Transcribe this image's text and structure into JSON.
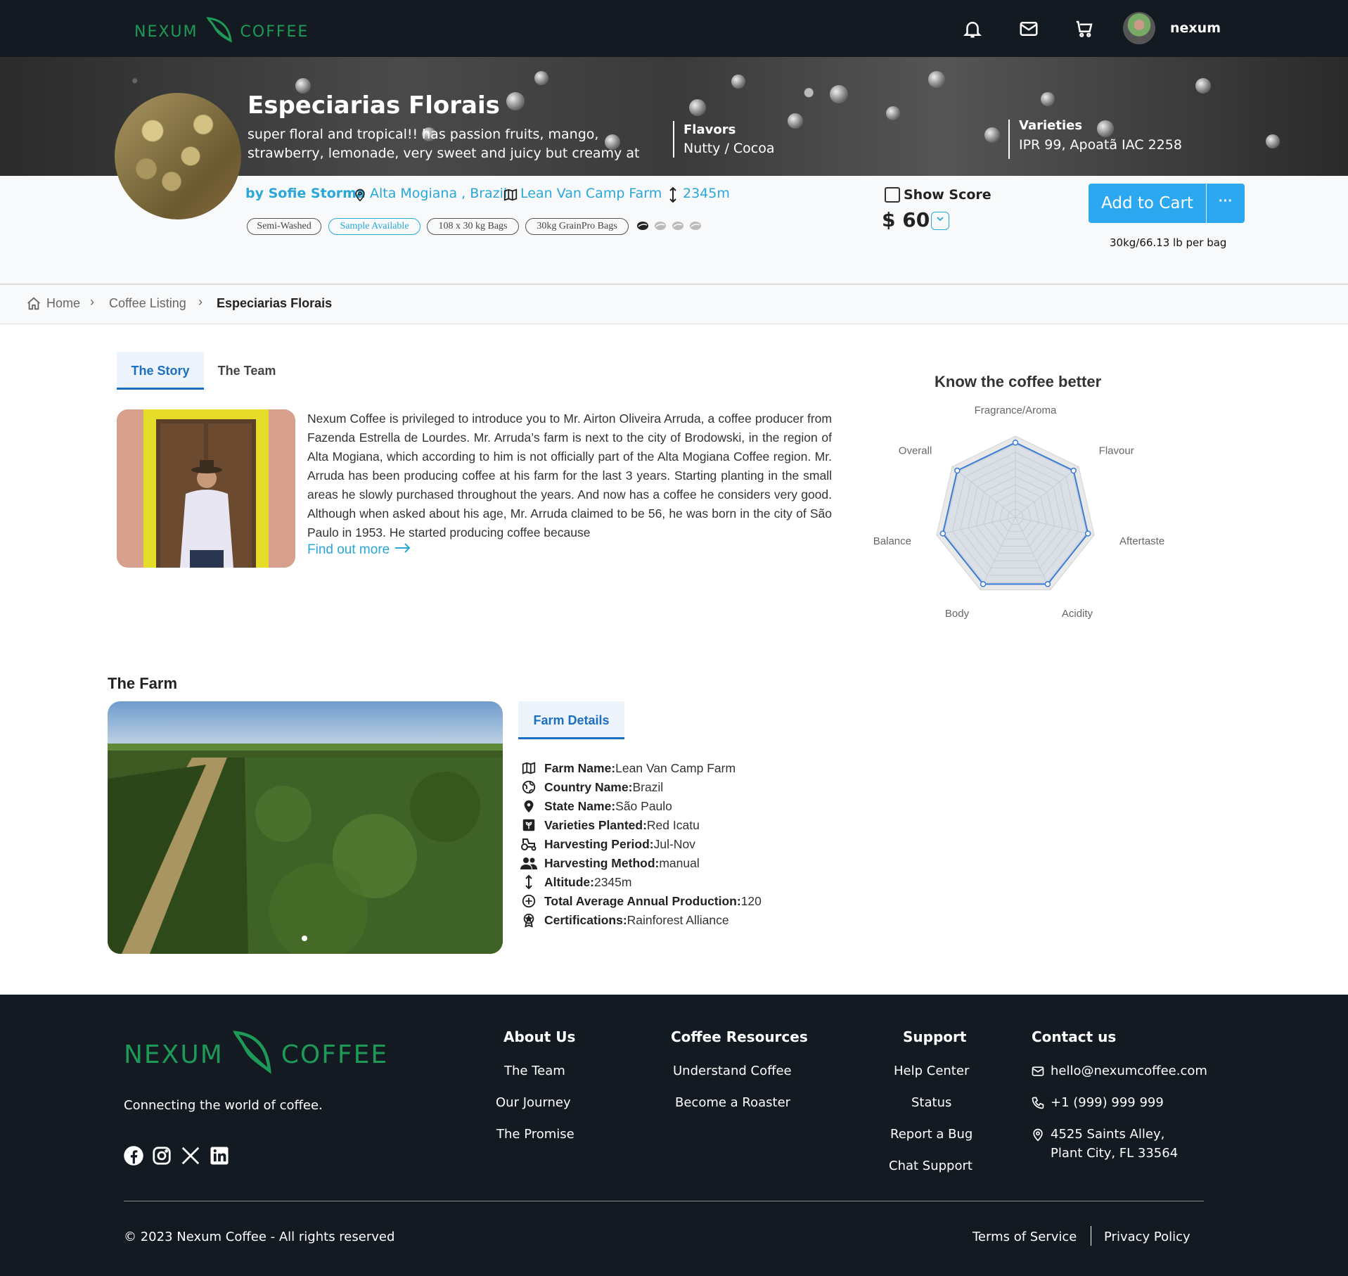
{
  "header": {
    "logo_left": "NEXUM",
    "logo_right": "COFFEE",
    "username": "nexum"
  },
  "hero": {
    "title": "Especiarias Florais",
    "description": "super floral and tropical!! has passion fruits, mango, strawberry, lemonade, very sweet and juicy but creamy at the",
    "flavors_label": "Flavors",
    "flavors_value": "Nutty / Cocoa",
    "varieties_label": "Varieties",
    "varieties_value": "IPR 99, Apoatã IAC 2258"
  },
  "info": {
    "producer": "by Sofie Storma",
    "location": "Alta Mogiana , Brazil",
    "farm": "Lean Van Camp Farm",
    "altitude": "2345m",
    "tags": [
      "Semi-Washed",
      "Sample Available",
      "108 x 30 kg Bags",
      "30kg GrainPro Bags"
    ],
    "roast_level": 1,
    "roast_max": 4,
    "show_score_label": "Show Score",
    "price": "$ 60",
    "add_to_cart": "Add to Cart",
    "more": "···",
    "bag_note": "30kg/66.13 lb per bag"
  },
  "breadcrumb": {
    "home": "Home",
    "listing": "Coffee Listing",
    "current": "Especiarias Florais"
  },
  "story": {
    "tab_story": "The Story",
    "tab_team": "The Team",
    "text": "Nexum Coffee is privileged to introduce you to Mr. Airton Oliveira Arruda, a coffee producer from Fazenda Estrella de Lourdes. Mr. Arruda’s farm is next to the city of Brodowski, in the region of Alta Mogiana, which according to him is not officially part of the Alta Mogiana Coffee region. Mr. Arruda has been producing coffee at his farm for the last 3 years. Starting planting in the small areas he slowly purchased throughout the years. And now has a coffee he considers very good. Although when asked about his age, Mr. Arruda claimed to be 56, he was born in the city of São Paulo in 1953. He started producing coffee because",
    "find_more": "Find out more"
  },
  "radar": {
    "title": "Know the coffee better",
    "axes": [
      "Fragrance/Aroma",
      "Flavour",
      "Aftertaste",
      "Acidity",
      "Body",
      "Balance",
      "Overall"
    ],
    "values": [
      0.92,
      0.92,
      0.92,
      0.92,
      0.92,
      0.92,
      0.92
    ],
    "color": "#3a7bd5"
  },
  "farm": {
    "title": "The Farm",
    "tab": "Farm Details",
    "rows": [
      {
        "label": "Farm Name:",
        "value": "Lean Van Camp Farm",
        "icon": "map-icon"
      },
      {
        "label": "Country Name:",
        "value": "Brazil",
        "icon": "globe-icon"
      },
      {
        "label": "State Name:",
        "value": "São Paulo",
        "icon": "pin-icon"
      },
      {
        "label": "Varieties Planted:",
        "value": "Red Icatu",
        "icon": "plant-icon"
      },
      {
        "label": "Harvesting Period:",
        "value": "Jul-Nov",
        "icon": "tractor-icon"
      },
      {
        "label": "Harvesting Method:",
        "value": "manual",
        "icon": "people-icon"
      },
      {
        "label": "Altitude:",
        "value": "2345m",
        "icon": "altitude-icon"
      },
      {
        "label": "Total Average Annual Production:",
        "value": "120",
        "icon": "plus-circle-icon"
      },
      {
        "label": "Certifications:",
        "value": "Rainforest Alliance",
        "icon": "award-icon"
      }
    ]
  },
  "footer": {
    "tagline": "Connecting the world of coffee.",
    "about_head": "About Us",
    "about_links": [
      "The Team",
      "Our Journey",
      "The Promise"
    ],
    "resources_head": "Coffee Resources",
    "resources_links": [
      "Understand Coffee",
      "Become a Roaster"
    ],
    "support_head": "Support",
    "support_links": [
      "Help Center",
      "Status",
      "Report a Bug",
      "Chat Support"
    ],
    "contact_head": "Contact us",
    "email": "hello@nexumcoffee.com",
    "phone": "+1 (999) 999 999",
    "address_line1": "4525 Saints Alley,",
    "address_line2": "Plant City, FL 33564",
    "copyright": "© 2023 Nexum Coffee - All rights reserved",
    "terms": "Terms of Service",
    "privacy": "Privacy Policy"
  }
}
